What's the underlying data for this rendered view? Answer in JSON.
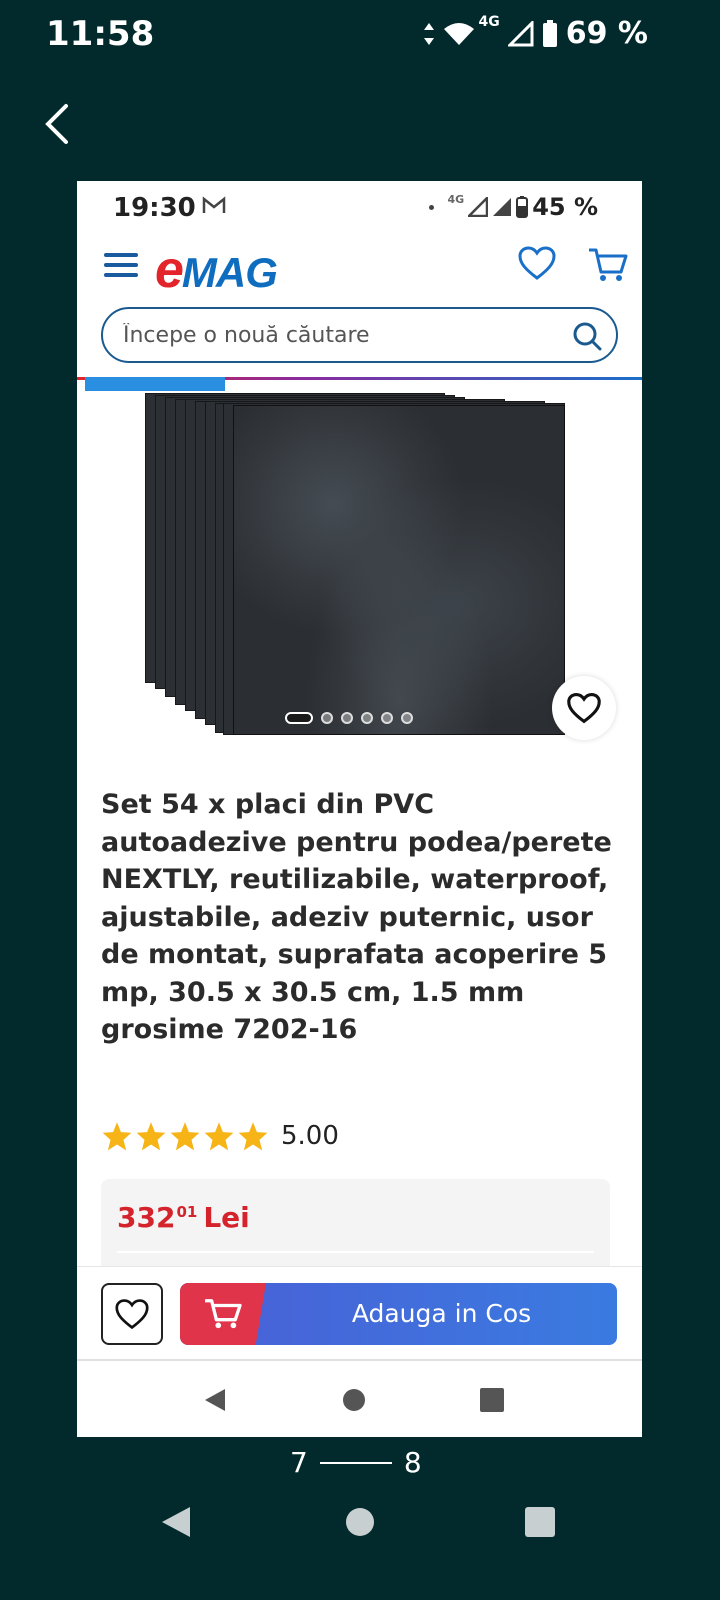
{
  "outer_status": {
    "time": "11:58",
    "network": "4G",
    "battery": "69 %"
  },
  "inner_status": {
    "time": "19:30",
    "network": "4G",
    "battery": "45 %"
  },
  "header": {
    "logo_e": "e",
    "logo_rest": "MAG"
  },
  "search": {
    "placeholder": "Începe o nouă căutare"
  },
  "product": {
    "title": "Set 54 x placi din PVC autoadezive pentru podea/perete NEXTLY, reutilizabile, waterproof, ajustabile, adeziv puternic, usor de montat, suprafata acoperire 5 mp, 30.5 x 30.5 cm, 1.5 mm grosime 7202-16",
    "rating": "5.00",
    "stars": 5,
    "price_main": "332",
    "price_cents": "01",
    "currency": "Lei",
    "carousel_count": 6,
    "carousel_active": 0
  },
  "actions": {
    "add_to_cart": "Adauga in Cos"
  },
  "pager": {
    "current": "7",
    "next": "8"
  },
  "colors": {
    "brand_red": "#e3242b",
    "brand_blue": "#0f6dbf",
    "price_red": "#d5232b",
    "background": "#022a2c"
  }
}
